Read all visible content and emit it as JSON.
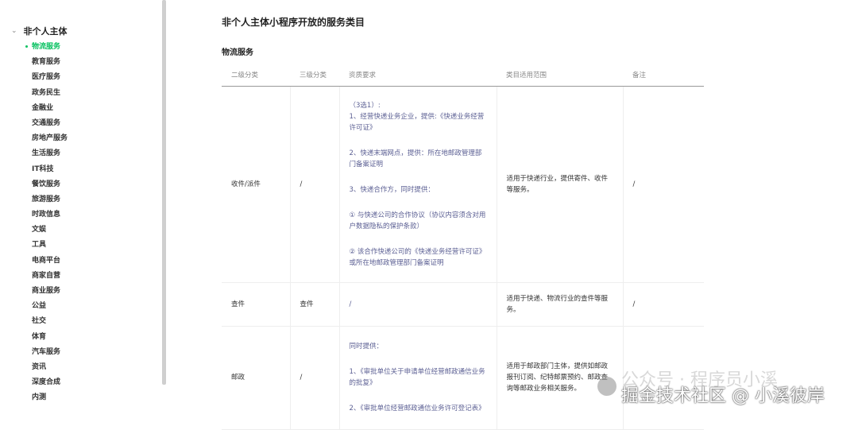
{
  "sidebar": {
    "group": "非个人主体",
    "items": [
      "物流服务",
      "教育服务",
      "医疗服务",
      "政务民生",
      "金融业",
      "交通服务",
      "房地产服务",
      "生活服务",
      "IT科技",
      "餐饮服务",
      "旅游服务",
      "时政信息",
      "文娱",
      "工具",
      "电商平台",
      "商家自营",
      "商业服务",
      "公益",
      "社交",
      "体育",
      "汽车服务",
      "资讯",
      "深度合成",
      "内测"
    ],
    "active_index": 0
  },
  "main": {
    "title": "非个人主体小程序开放的服务类目",
    "section": "物流服务",
    "headers": [
      "二级分类",
      "三级分类",
      "资质要求",
      "类目适用范围",
      "备注"
    ],
    "rows": [
      {
        "l2": "收件/派件",
        "l3": "/",
        "req": [
          "（3选1）:\n1、经营快递业务企业，提供:《快递业务经营许可证》",
          "2、快递末端网点，提供：所在地邮政管理部门备案证明",
          "3、快递合作方，同时提供：",
          "① 与快递公司的合作协议（协议内容须含对用户数据隐私的保护条款）",
          "② 该合作快递公司的《快递业务经营许可证》或所在地邮政管理部门备案证明"
        ],
        "scope": "适用于快递行业，提供寄件、收件等服务。",
        "note": "/"
      },
      {
        "l2": "查件",
        "l3": "查件",
        "req": [
          "/"
        ],
        "scope": "适用于快递、物流行业的查件等服务。",
        "note": "/"
      },
      {
        "l2": "邮政",
        "l3": "/",
        "req": [
          "同时提供：",
          "1、《审批单位关于申请单位经营邮政通信业务的批复》",
          "2、《审批单位经营邮政通信业务许可登记表》"
        ],
        "scope": "适用于邮政部门主体，提供如邮政报刊订阅、纪特邮票预约、邮政查询等邮政业务相关服务。",
        "note": ""
      }
    ]
  },
  "watermark": {
    "line1": "公众号 · 程序员小溪",
    "line2": "掘金技术社区 @ 小溪彼岸"
  }
}
